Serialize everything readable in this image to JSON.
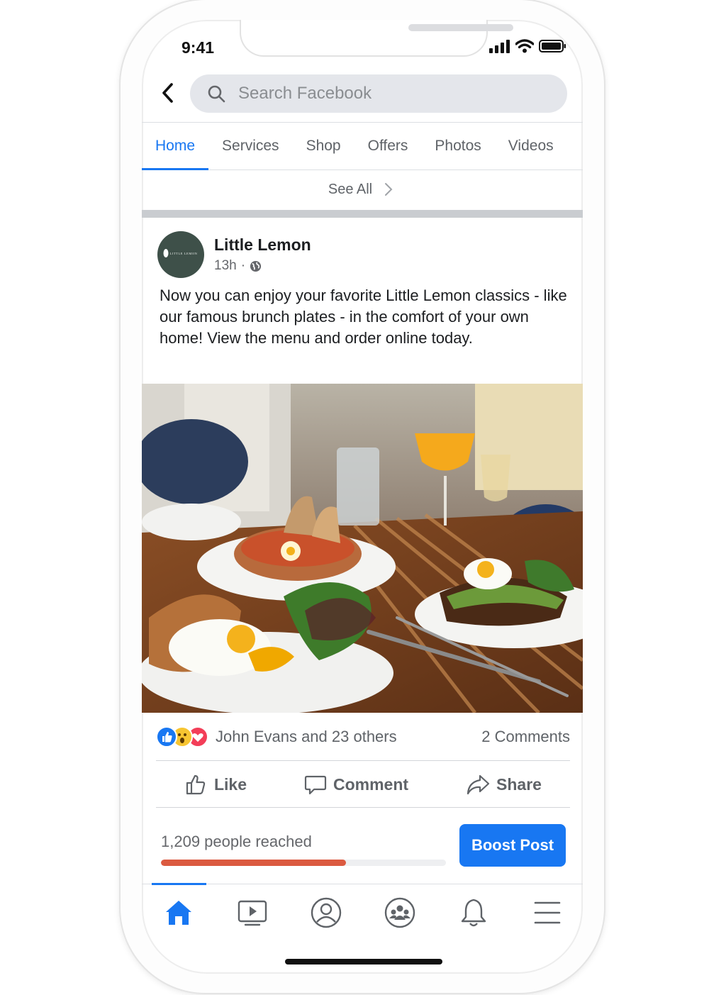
{
  "status_bar": {
    "time": "9:41"
  },
  "search": {
    "placeholder": "Search Facebook"
  },
  "tabs": [
    {
      "label": "Home",
      "active": true
    },
    {
      "label": "Services"
    },
    {
      "label": "Shop"
    },
    {
      "label": "Offers"
    },
    {
      "label": "Photos"
    },
    {
      "label": "Videos"
    }
  ],
  "see_all": "See All",
  "post": {
    "page_name": "Little Lemon",
    "avatar_text": "LITTLE LEMON",
    "time": "13h",
    "audience_icon": "globe-icon",
    "text": "Now you can enjoy your favorite Little Lemon classics -  like our famous brunch plates - in the comfort of your own home! View the menu and order online today.",
    "image_alt": "brunch plates with eggs, avocado toast and salad",
    "reactions": [
      "like",
      "wow",
      "love"
    ],
    "reaction_names": "John Evans and 23 others",
    "comments_count": "2 Comments",
    "actions": {
      "like": "Like",
      "comment": "Comment",
      "share": "Share"
    }
  },
  "insights": {
    "reached": "1,209 people reached",
    "progress": 0.65,
    "boost_label": "Boost Post"
  },
  "bottom_nav": {
    "items": [
      "home-icon",
      "watch-icon",
      "profile-icon",
      "groups-icon",
      "notifications-icon",
      "menu-icon"
    ],
    "active": "home-icon"
  },
  "colors": {
    "accent": "#1877f2",
    "progress": "#db5a40",
    "avatar": "#3e5049"
  }
}
